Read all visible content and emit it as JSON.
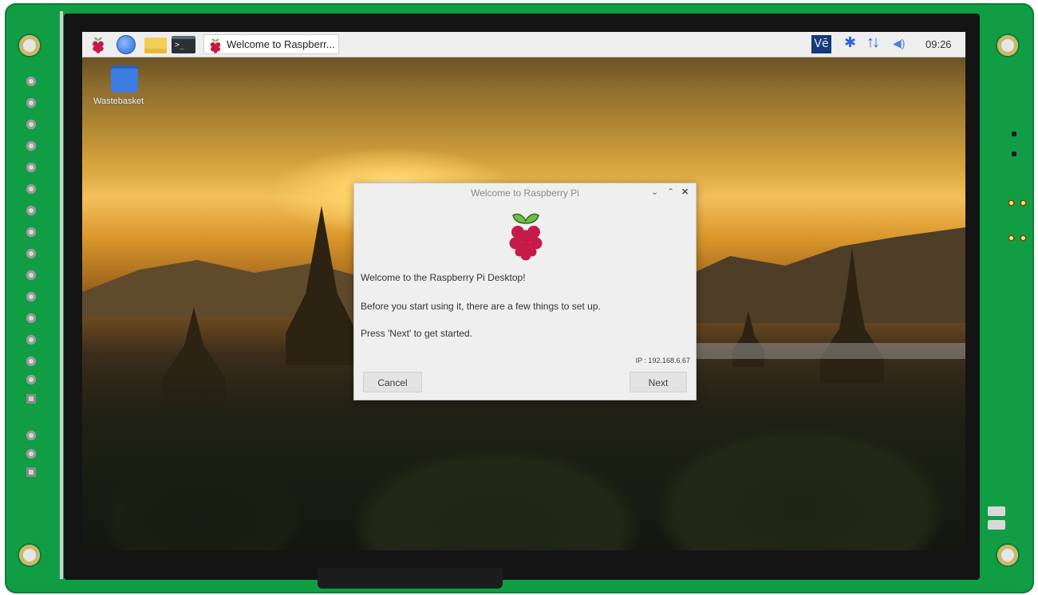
{
  "taskbar": {
    "terminal_prompt": ">_",
    "active_window": "Welcome to Raspberr...",
    "vnc_badge": "Vē",
    "clock": "09:26"
  },
  "desktop": {
    "icons": [
      {
        "label": "Wastebasket",
        "icon": "trash-icon"
      }
    ]
  },
  "dialog": {
    "title": "Welcome to Raspberry Pi",
    "controls": {
      "minimize": "⌄",
      "maximize": "⌃",
      "close": "✕"
    },
    "lines": [
      "Welcome to the Raspberry Pi Desktop!",
      "Before you start using it, there are a few things to set up.",
      "Press 'Next' to get started."
    ],
    "ip": "IP : 192.168.6.67",
    "cancel_label": "Cancel",
    "next_label": "Next"
  },
  "colors": {
    "pcb": "#119d44",
    "taskbar": "#eeeeee",
    "dialog": "#efefef",
    "raspberry": "#c51a4a",
    "leaf": "#6cc04a",
    "accent_blue": "#2a63d9"
  }
}
